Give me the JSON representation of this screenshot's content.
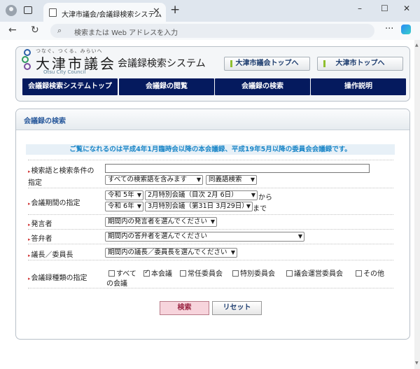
{
  "browser": {
    "tab_title": "大津市議会/会議録検索システム",
    "address_placeholder": "検索または Web アドレスを入力",
    "new_tab": "+",
    "close_tab": "✕",
    "window_controls": [
      "–",
      "☐",
      "✕"
    ],
    "more_label": "···"
  },
  "header": {
    "tagline": "つなぐ、つくる、みらいへ",
    "city_name": "大津市議会",
    "city_name_en": "Otsu City Council",
    "system_name": "会議録検索システム",
    "top_links": [
      "大津市議会トップへ",
      "大津市トップへ"
    ],
    "nav": [
      "会議録検索システムトップ",
      "会議録の閲覧",
      "会議録の検索",
      "操作説明"
    ],
    "logo_colors": [
      "#2a5fa8",
      "#2f9b5f",
      "#7a4fa0"
    ]
  },
  "panel": {
    "title": "会議録の検索",
    "notice": "ご覧になれるのは平成4年1月臨時会以降の本会議録、平成19年5月以降の委員会会議録です。"
  },
  "form": {
    "keyword_label_1": "検索語と検索条件の",
    "keyword_label_2": "指定",
    "keyword_value": "",
    "condition_select": "すべての検索語を含みます",
    "synonym_select": "同義語検索",
    "period_label": "会議期間の指定",
    "from_year": "令和 5年",
    "from_session": "2月特別会議（目次 2月 6日）",
    "from_suffix": "から",
    "to_year": "令和 6年",
    "to_session": "3月特別会議（第31日 3月29日）",
    "to_suffix": "まで",
    "speaker_label": "発言者",
    "speaker_select": "期間内の発言者を選んでください",
    "answerer_label": "答弁者",
    "answerer_select": "期間内の答弁者を選んでください",
    "chair_label": "議長／委員長",
    "chair_select": "期間内の議長／委員長を選んでください",
    "types_label": "会議録種類の指定",
    "types": [
      {
        "label": "すべて",
        "checked": false
      },
      {
        "label": "本会議",
        "checked": true
      },
      {
        "label": "常任委員会",
        "checked": false
      },
      {
        "label": "特別委員会",
        "checked": false
      },
      {
        "label": "議会運営委員会",
        "checked": false
      },
      {
        "label": "その他",
        "checked": false
      }
    ],
    "types_wrap": "の会議",
    "search_button": "検索",
    "reset_button": "リセット"
  }
}
